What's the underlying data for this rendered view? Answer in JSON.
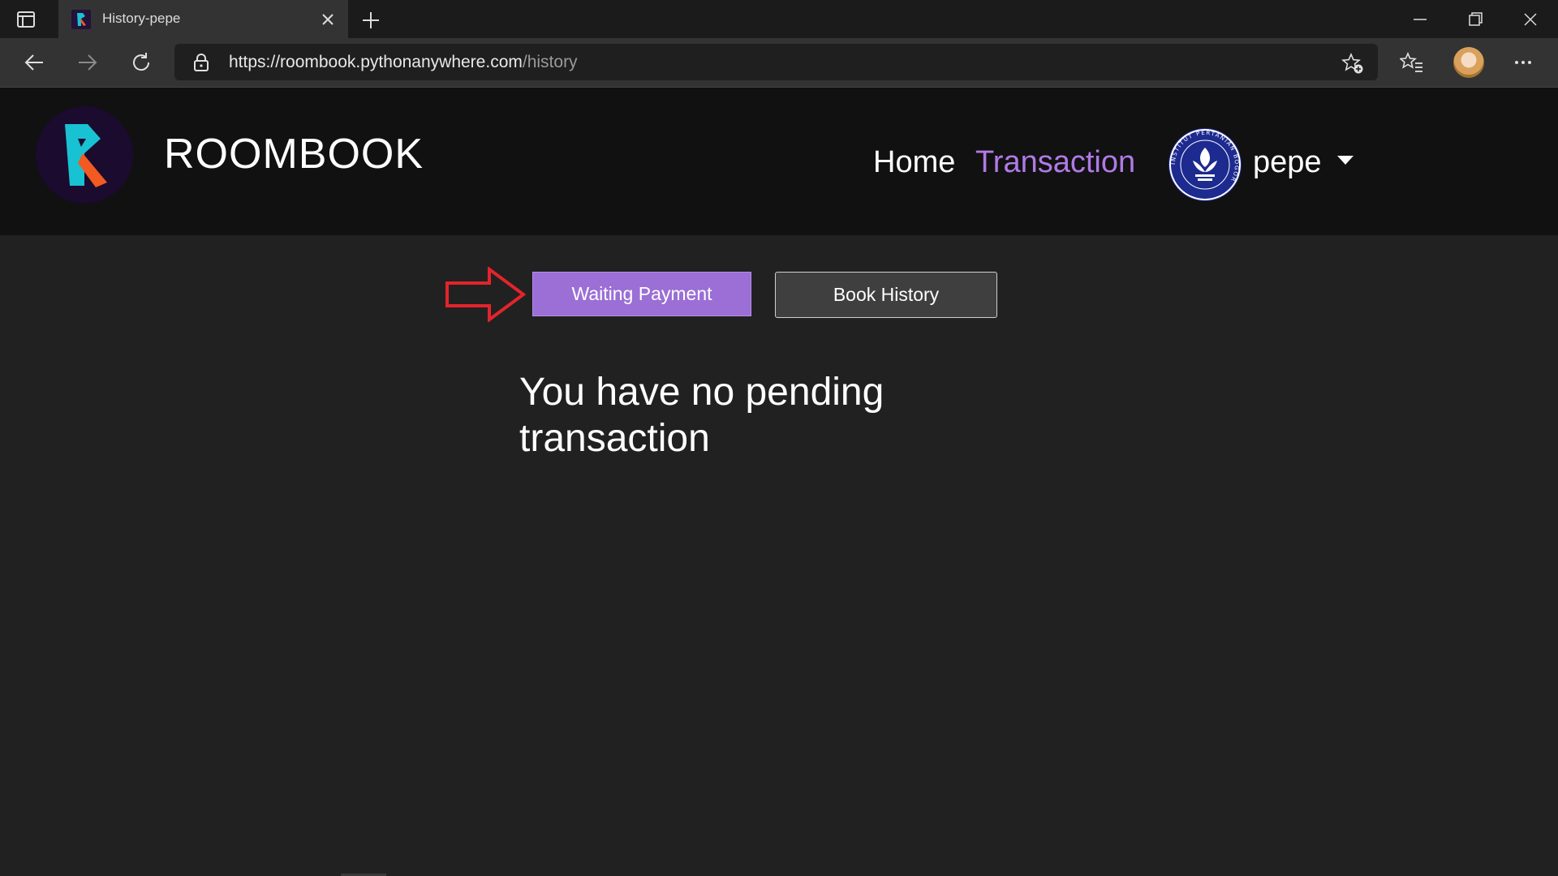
{
  "browser": {
    "tab": {
      "title": "History-pepe"
    },
    "address": {
      "url_host": "https://roombook.pythonanywhere.com",
      "url_path": "/history"
    }
  },
  "navbar": {
    "brand": "ROOMBOOK",
    "links": {
      "home": "Home",
      "transaction": "Transaction"
    },
    "user": {
      "name": "pepe",
      "avatar_text": "INSTITUT PERTANIAN BOGOR"
    }
  },
  "content": {
    "tabs": {
      "waiting": "Waiting Payment",
      "history": "Book History"
    },
    "message": "You have no pending transaction"
  },
  "colors": {
    "accent": "#9b6fd6",
    "active_link": "#b07ae6",
    "page_bg": "#212121",
    "navbar_bg": "#111111",
    "annotation_arrow": "#e3242b"
  },
  "icons": {
    "tab_actions": "tab-actions-icon",
    "back": "back-arrow-icon",
    "forward": "forward-arrow-icon",
    "reload": "reload-icon",
    "lock": "lock-icon",
    "add_favorite": "star-add-icon",
    "favorites": "favorites-list-icon",
    "more": "more-dots-icon",
    "caret": "caret-down-icon"
  }
}
